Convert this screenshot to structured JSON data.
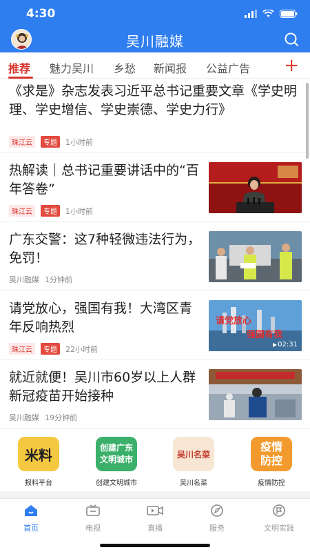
{
  "status": {
    "time": "4:30"
  },
  "header": {
    "title": "吴川融媒"
  },
  "tabs": [
    "推荐",
    "魅力吴川",
    "乡愁",
    "新闻报",
    "公益广告"
  ],
  "plus_label": "+",
  "articles": [
    {
      "headline": "《求是》杂志发表习近平总书记重要文章《学史明理、学史增信、学史崇德、学史力行》",
      "source": "珠江云",
      "tag": "专题",
      "time": "1小时前"
    },
    {
      "headline": "热解读｜总书记重要讲话中的“百年答卷”",
      "source": "珠江云",
      "tag": "专题",
      "time": "1小时前"
    },
    {
      "headline": "广东交警：这7种轻微违法行为，免罚！",
      "source": "吴川融媒",
      "time": "1分钟前"
    },
    {
      "headline": "请党放心，强国有我！大湾区青年反响热烈",
      "source": "珠江云",
      "tag": "专题",
      "time": "22小时前",
      "video_duration": "02:31"
    },
    {
      "headline": "就近就便！吴川市60岁以上人群新冠疫苗开始接种",
      "source": "吴川融媒",
      "time": "19分钟前"
    }
  ],
  "apps": [
    {
      "label": "报料平台",
      "icon_text": "米料",
      "color": "#f5c842",
      "text_color": "#222222"
    },
    {
      "label": "创建文明城市",
      "icon_text": "创建广东\n文明城市",
      "color": "#3bb06a",
      "text_color": "#ffffff"
    },
    {
      "label": "吴川名菜",
      "icon_text": "吴川名菜",
      "color": "#f7e6d3",
      "text_color": "#c0392b"
    },
    {
      "label": "疫情防控",
      "icon_text": "疫情\n防控",
      "color": "#f29a2e",
      "text_color": "#ffffff"
    }
  ],
  "nav": [
    {
      "label": "首页",
      "icon": "home-icon"
    },
    {
      "label": "电视",
      "icon": "tv-icon"
    },
    {
      "label": "直播",
      "icon": "video-camera-icon"
    },
    {
      "label": "服务",
      "icon": "compass-icon"
    },
    {
      "label": "文明实践",
      "icon": "flag-icon"
    }
  ],
  "colors": {
    "accent": "#2f7ef0",
    "active_tab": "#d9312a"
  }
}
